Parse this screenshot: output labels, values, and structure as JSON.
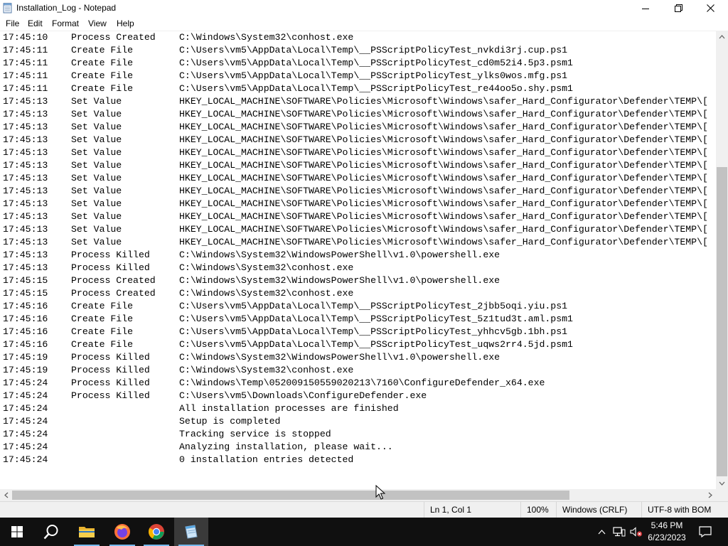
{
  "window": {
    "title": "Installation_Log - Notepad"
  },
  "menu": [
    "File",
    "Edit",
    "Format",
    "View",
    "Help"
  ],
  "log": [
    {
      "time": "17:45:10",
      "action": "Process Created",
      "path": "C:\\Windows\\System32\\conhost.exe"
    },
    {
      "time": "17:45:11",
      "action": "Create File",
      "path": "C:\\Users\\vm5\\AppData\\Local\\Temp\\__PSScriptPolicyTest_nvkdi3rj.cup.ps1"
    },
    {
      "time": "17:45:11",
      "action": "Create File",
      "path": "C:\\Users\\vm5\\AppData\\Local\\Temp\\__PSScriptPolicyTest_cd0m52i4.5p3.psm1"
    },
    {
      "time": "17:45:11",
      "action": "Create File",
      "path": "C:\\Users\\vm5\\AppData\\Local\\Temp\\__PSScriptPolicyTest_ylks0wos.mfg.ps1"
    },
    {
      "time": "17:45:11",
      "action": "Create File",
      "path": "C:\\Users\\vm5\\AppData\\Local\\Temp\\__PSScriptPolicyTest_re44oo5o.shy.psm1"
    },
    {
      "time": "17:45:13",
      "action": "Set Value",
      "path": "HKEY_LOCAL_MACHINE\\SOFTWARE\\Policies\\Microsoft\\Windows\\safer_Hard_Configurator\\Defender\\TEMP\\["
    },
    {
      "time": "17:45:13",
      "action": "Set Value",
      "path": "HKEY_LOCAL_MACHINE\\SOFTWARE\\Policies\\Microsoft\\Windows\\safer_Hard_Configurator\\Defender\\TEMP\\["
    },
    {
      "time": "17:45:13",
      "action": "Set Value",
      "path": "HKEY_LOCAL_MACHINE\\SOFTWARE\\Policies\\Microsoft\\Windows\\safer_Hard_Configurator\\Defender\\TEMP\\["
    },
    {
      "time": "17:45:13",
      "action": "Set Value",
      "path": "HKEY_LOCAL_MACHINE\\SOFTWARE\\Policies\\Microsoft\\Windows\\safer_Hard_Configurator\\Defender\\TEMP\\["
    },
    {
      "time": "17:45:13",
      "action": "Set Value",
      "path": "HKEY_LOCAL_MACHINE\\SOFTWARE\\Policies\\Microsoft\\Windows\\safer_Hard_Configurator\\Defender\\TEMP\\["
    },
    {
      "time": "17:45:13",
      "action": "Set Value",
      "path": "HKEY_LOCAL_MACHINE\\SOFTWARE\\Policies\\Microsoft\\Windows\\safer_Hard_Configurator\\Defender\\TEMP\\["
    },
    {
      "time": "17:45:13",
      "action": "Set Value",
      "path": "HKEY_LOCAL_MACHINE\\SOFTWARE\\Policies\\Microsoft\\Windows\\safer_Hard_Configurator\\Defender\\TEMP\\["
    },
    {
      "time": "17:45:13",
      "action": "Set Value",
      "path": "HKEY_LOCAL_MACHINE\\SOFTWARE\\Policies\\Microsoft\\Windows\\safer_Hard_Configurator\\Defender\\TEMP\\["
    },
    {
      "time": "17:45:13",
      "action": "Set Value",
      "path": "HKEY_LOCAL_MACHINE\\SOFTWARE\\Policies\\Microsoft\\Windows\\safer_Hard_Configurator\\Defender\\TEMP\\["
    },
    {
      "time": "17:45:13",
      "action": "Set Value",
      "path": "HKEY_LOCAL_MACHINE\\SOFTWARE\\Policies\\Microsoft\\Windows\\safer_Hard_Configurator\\Defender\\TEMP\\["
    },
    {
      "time": "17:45:13",
      "action": "Set Value",
      "path": "HKEY_LOCAL_MACHINE\\SOFTWARE\\Policies\\Microsoft\\Windows\\safer_Hard_Configurator\\Defender\\TEMP\\["
    },
    {
      "time": "17:45:13",
      "action": "Set Value",
      "path": "HKEY_LOCAL_MACHINE\\SOFTWARE\\Policies\\Microsoft\\Windows\\safer_Hard_Configurator\\Defender\\TEMP\\["
    },
    {
      "time": "17:45:13",
      "action": "Process Killed",
      "path": "C:\\Windows\\System32\\WindowsPowerShell\\v1.0\\powershell.exe"
    },
    {
      "time": "17:45:13",
      "action": "Process Killed",
      "path": "C:\\Windows\\System32\\conhost.exe"
    },
    {
      "time": "17:45:15",
      "action": "Process Created",
      "path": "C:\\Windows\\System32\\WindowsPowerShell\\v1.0\\powershell.exe"
    },
    {
      "time": "17:45:15",
      "action": "Process Created",
      "path": "C:\\Windows\\System32\\conhost.exe"
    },
    {
      "time": "17:45:16",
      "action": "Create File",
      "path": "C:\\Users\\vm5\\AppData\\Local\\Temp\\__PSScriptPolicyTest_2jbb5oqi.yiu.ps1"
    },
    {
      "time": "17:45:16",
      "action": "Create File",
      "path": "C:\\Users\\vm5\\AppData\\Local\\Temp\\__PSScriptPolicyTest_5z1tud3t.aml.psm1"
    },
    {
      "time": "17:45:16",
      "action": "Create File",
      "path": "C:\\Users\\vm5\\AppData\\Local\\Temp\\__PSScriptPolicyTest_yhhcv5gb.1bh.ps1"
    },
    {
      "time": "17:45:16",
      "action": "Create File",
      "path": "C:\\Users\\vm5\\AppData\\Local\\Temp\\__PSScriptPolicyTest_uqws2rr4.5jd.psm1"
    },
    {
      "time": "17:45:19",
      "action": "Process Killed",
      "path": "C:\\Windows\\System32\\WindowsPowerShell\\v1.0\\powershell.exe"
    },
    {
      "time": "17:45:19",
      "action": "Process Killed",
      "path": "C:\\Windows\\System32\\conhost.exe"
    },
    {
      "time": "17:45:24",
      "action": "Process Killed",
      "path": "C:\\Windows\\Temp\\052009150559020213\\7160\\ConfigureDefender_x64.exe"
    },
    {
      "time": "17:45:24",
      "action": "Process Killed",
      "path": "C:\\Users\\vm5\\Downloads\\ConfigureDefender.exe"
    },
    {
      "time": "17:45:24",
      "action": "",
      "path": "All installation processes are finished"
    },
    {
      "time": "17:45:24",
      "action": "",
      "path": "Setup is completed"
    },
    {
      "time": "17:45:24",
      "action": "",
      "path": "Tracking service is stopped"
    },
    {
      "time": "17:45:24",
      "action": "",
      "path": "Analyzing installation, please wait..."
    },
    {
      "time": "17:45:24",
      "action": "",
      "path": "0 installation entries detected"
    }
  ],
  "status": {
    "position": "Ln 1, Col 1",
    "zoom": "100%",
    "line_ending": "Windows (CRLF)",
    "encoding": "UTF-8 with BOM"
  },
  "taskbar": {
    "apps": [
      "start-icon",
      "search-icon",
      "file-explorer-icon",
      "firefox-icon",
      "chrome-icon",
      "notepad-icon"
    ],
    "active_app": "notepad-icon",
    "clock_time": "5:46 PM",
    "clock_date": "6/23/2023"
  },
  "colors": {
    "taskbar": "#101010",
    "accent": "#76b9ed",
    "scroll_thumb": "#c2c2c2"
  }
}
